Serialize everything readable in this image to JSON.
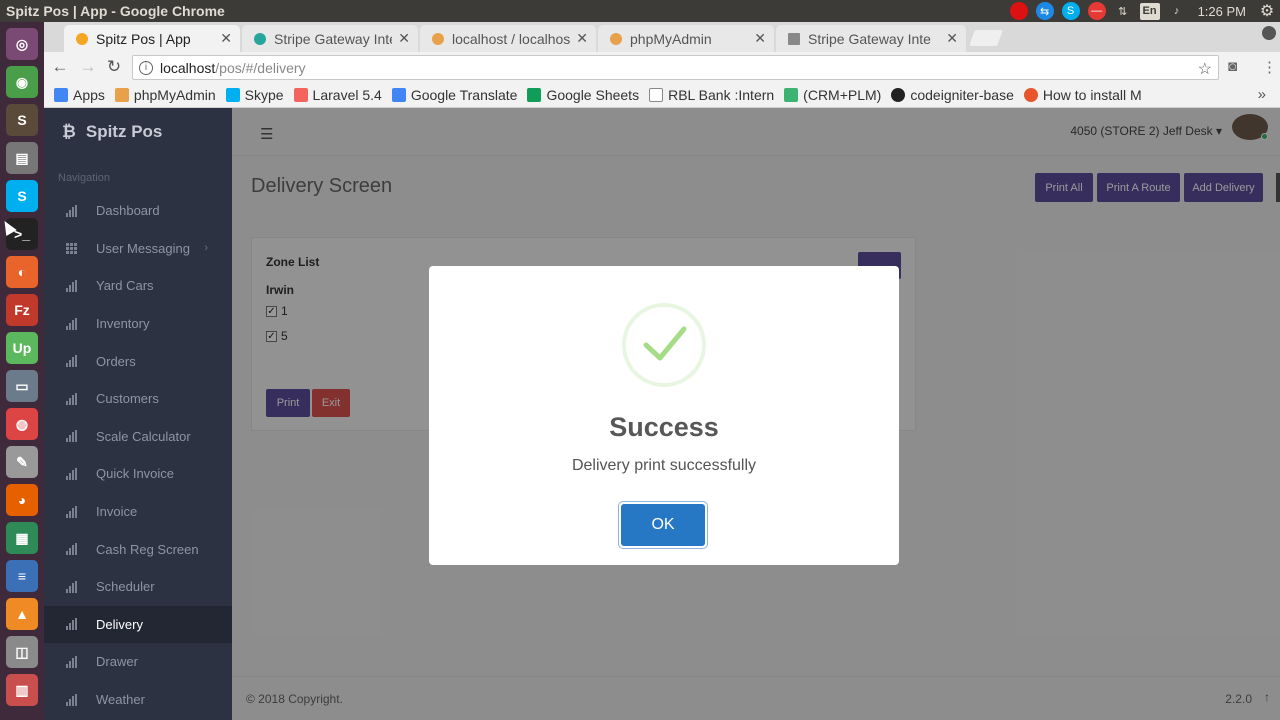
{
  "os": {
    "window_title": "Spitz Pos | App - Google Chrome",
    "clock": "1:26 PM",
    "keyboard_layout": "En"
  },
  "browser": {
    "tabs": [
      {
        "label": "Spitz Pos | App",
        "active": true,
        "favicon_color": "#f5a623"
      },
      {
        "label": "Stripe Gateway Inte",
        "active": false,
        "favicon_color": "#26a69a"
      },
      {
        "label": "localhost / localhos",
        "active": false,
        "favicon_color": "#e8a04a"
      },
      {
        "label": "phpMyAdmin",
        "active": false,
        "favicon_color": "#e8a04a"
      },
      {
        "label": "Stripe Gateway Inte",
        "active": false,
        "favicon_color": "#888888"
      }
    ],
    "url_host": "localhost",
    "url_path": "/pos/#/delivery",
    "bookmarks": [
      {
        "label": "Apps",
        "icon_color": "#4285f4"
      },
      {
        "label": "phpMyAdmin",
        "icon_color": "#e8a04a"
      },
      {
        "label": "Skype",
        "icon_color": "#00aff0"
      },
      {
        "label": "Laravel 5.4",
        "icon_color": "#f4645f"
      },
      {
        "label": "Google Translate",
        "icon_color": "#4285f4"
      },
      {
        "label": "Google Sheets",
        "icon_color": "#0f9d58"
      },
      {
        "label": "RBL Bank :Intern",
        "icon_color": "#888888"
      },
      {
        "label": "(CRM+PLM)",
        "icon_color": "#3cb371"
      },
      {
        "label": "codeigniter-base",
        "icon_color": "#222222"
      },
      {
        "label": "How to install M",
        "icon_color": "#e8552c"
      }
    ]
  },
  "app": {
    "brand": "Spitz Pos",
    "nav_heading": "Navigation",
    "nav_items": [
      {
        "label": "Dashboard",
        "icon": "bar-chart-icon"
      },
      {
        "label": "User Messaging",
        "icon": "grid-icon",
        "has_submenu": true
      },
      {
        "label": "Yard Cars",
        "icon": "bar-chart-icon"
      },
      {
        "label": "Inventory",
        "icon": "bar-chart-icon"
      },
      {
        "label": "Orders",
        "icon": "bar-chart-icon"
      },
      {
        "label": "Customers",
        "icon": "bar-chart-icon"
      },
      {
        "label": "Scale Calculator",
        "icon": "bar-chart-icon"
      },
      {
        "label": "Quick Invoice",
        "icon": "bar-chart-icon"
      },
      {
        "label": "Invoice",
        "icon": "bar-chart-icon"
      },
      {
        "label": "Cash Reg Screen",
        "icon": "bar-chart-icon"
      },
      {
        "label": "Scheduler",
        "icon": "bar-chart-icon"
      },
      {
        "label": "Delivery",
        "icon": "bar-chart-icon",
        "active": true
      },
      {
        "label": "Drawer",
        "icon": "bar-chart-icon"
      },
      {
        "label": "Weather",
        "icon": "bar-chart-icon"
      }
    ],
    "user_label": "4050 (STORE 2) Jeff Desk",
    "page_title": "Delivery Screen",
    "header_buttons": [
      "Print All",
      "Print A Route",
      "Add Delivery"
    ],
    "zone_card": {
      "title": "Zone List",
      "zone_name": "Irwin",
      "rows": [
        {
          "label": "1",
          "checked": true
        },
        {
          "label": "5",
          "checked": true
        }
      ],
      "print_label": "Print",
      "exit_label": "Exit"
    },
    "footer": {
      "copyright": "© 2018 Copyright.",
      "version": "2.2.0"
    }
  },
  "modal": {
    "title": "Success",
    "message": "Delivery print successfully",
    "ok_label": "OK"
  },
  "colors": {
    "primary": "#5c4e9c",
    "danger": "#d9534f",
    "ok_button": "#2778c4",
    "success_check": "#a5dc86",
    "sidebar": "#2d3242"
  }
}
